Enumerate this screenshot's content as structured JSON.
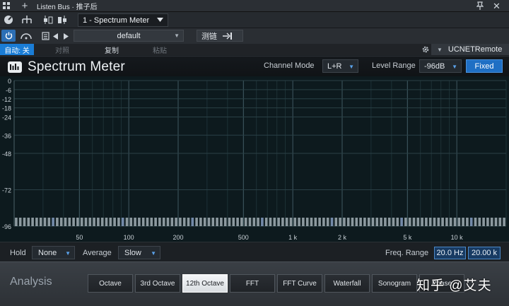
{
  "titlebar": {
    "title": "Listen Bus · 推子后"
  },
  "toolbar": {
    "plugin_name": "1 - Spectrum Meter"
  },
  "preset_row": {
    "preset": "default",
    "compare_label": "测链"
  },
  "edit_row": {
    "auto_label": "自动: 关",
    "compare": "对照",
    "copy": "复制",
    "paste": "粘贴",
    "remote": "UCNETRemote"
  },
  "plugin": {
    "name": "Spectrum Meter",
    "channel_mode_label": "Channel Mode",
    "channel_mode": "L+R",
    "level_range_label": "Level Range",
    "level_range": "-96dB",
    "fixed_label": "Fixed"
  },
  "controls": {
    "hold_label": "Hold",
    "hold_value": "None",
    "average_label": "Average",
    "average_value": "Slow",
    "freq_range_label": "Freq. Range",
    "freq_low": "20.0 Hz",
    "freq_high": "20.00 k"
  },
  "analysis": {
    "label": "Analysis",
    "tabs": [
      "Octave",
      "3rd Octave",
      "12th Octave",
      "FFT",
      "FFT Curve",
      "Waterfall",
      "Sonogram",
      "Phase"
    ],
    "active_tab": 2
  },
  "watermark": "知乎 @艾夫",
  "colors": {
    "accent": "#1f6fc4",
    "graph_bg": "#0d1a1e"
  },
  "chart_data": {
    "type": "bar",
    "y_ticks": [
      "0",
      "-6",
      "-12",
      "-18",
      "-24",
      "-36",
      "-48",
      "-72",
      "-96"
    ],
    "y_values": [
      0,
      -6,
      -12,
      -18,
      -24,
      -36,
      -48,
      -72,
      -96
    ],
    "x_ticks": [
      "50",
      "100",
      "200",
      "500",
      "1 k",
      "2 k",
      "5 k",
      "10 k"
    ],
    "x_values": [
      50,
      100,
      200,
      500,
      1000,
      2000,
      5000,
      10000
    ],
    "xlim": [
      20,
      20000
    ],
    "ylim": [
      -96,
      0
    ],
    "x_scale": "log",
    "band_count": 120,
    "band_level": -96
  }
}
